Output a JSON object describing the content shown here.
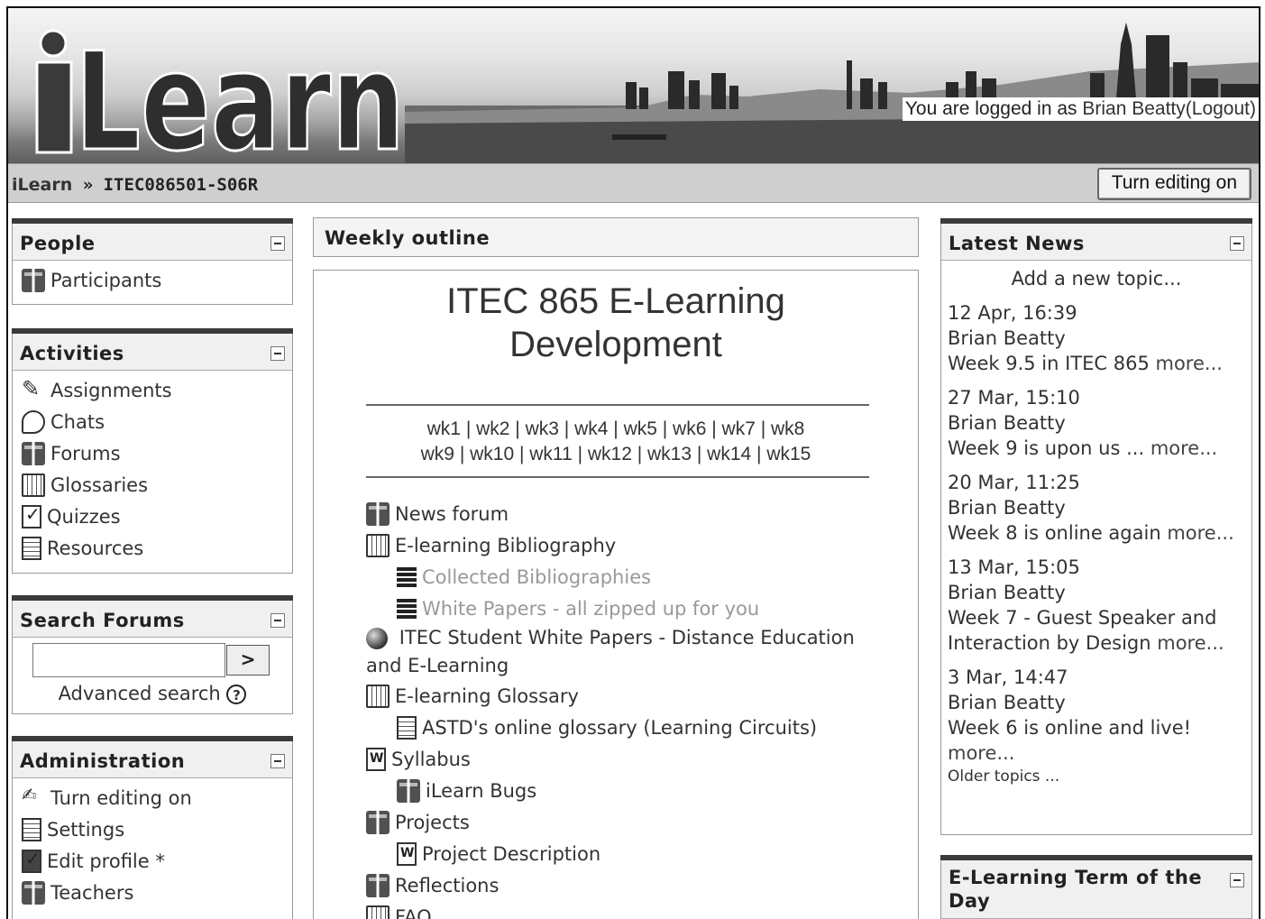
{
  "header": {
    "logo_text": "iLearn",
    "login_prefix": "You are logged in as",
    "user_name": "Brian Beatty",
    "logout_label": "(Logout)"
  },
  "navbar": {
    "home": "iLearn",
    "separator": "»",
    "course_code": "ITEC086501-S06R",
    "edit_button": "Turn editing on"
  },
  "people": {
    "title": "People",
    "items": [
      {
        "label": "Participants",
        "icon": "forum-icon"
      }
    ]
  },
  "activities": {
    "title": "Activities",
    "items": [
      {
        "label": "Assignments",
        "icon": "assignment-icon"
      },
      {
        "label": "Chats",
        "icon": "chat-icon"
      },
      {
        "label": "Forums",
        "icon": "forum-icon"
      },
      {
        "label": "Glossaries",
        "icon": "glossary-icon"
      },
      {
        "label": "Quizzes",
        "icon": "quiz-icon"
      },
      {
        "label": "Resources",
        "icon": "resource-icon"
      }
    ]
  },
  "search_forums": {
    "title": "Search Forums",
    "go_label": ">",
    "advanced_label": "Advanced search",
    "help_label": "?"
  },
  "administration": {
    "title": "Administration",
    "items": [
      {
        "label": "Turn editing on",
        "icon": "edit-pen-icon"
      },
      {
        "label": "Settings",
        "icon": "settings-icon"
      },
      {
        "label": "Edit profile *",
        "icon": "profile-icon"
      },
      {
        "label": "Teachers",
        "icon": "forum-icon"
      }
    ]
  },
  "weekly_outline": {
    "title": "Weekly outline",
    "course_title_line1": "ITEC 865 E-Learning",
    "course_title_line2": "Development",
    "weeks_row1": [
      "wk1",
      "wk2",
      "wk3",
      "wk4",
      "wk5",
      "wk6",
      "wk7",
      "wk8"
    ],
    "weeks_row2": [
      "wk9",
      "wk10",
      "wk11",
      "wk12",
      "wk13",
      "wk14",
      "wk15"
    ],
    "resources": [
      {
        "label": "News forum",
        "icon": "forum-icon"
      },
      {
        "label": "E-learning Bibliography",
        "icon": "glossary-icon"
      },
      {
        "label": "Collected Bibliographies",
        "icon": "stack-icon"
      },
      {
        "label": "White Papers - all zipped up for you",
        "icon": "stack-icon"
      },
      {
        "label_line1": "ITEC Student White Papers - Distance Education",
        "label_line2": "and E-Learning",
        "icon": "globe-icon"
      },
      {
        "label": "E-learning Glossary",
        "icon": "glossary-icon"
      },
      {
        "label": "ASTD's online glossary (Learning Circuits)",
        "icon": "file-icon"
      },
      {
        "label": "Syllabus",
        "icon": "word-doc-icon"
      },
      {
        "label": "iLearn Bugs",
        "icon": "forum-icon"
      },
      {
        "label": "Projects",
        "icon": "forum-icon"
      },
      {
        "label": "Project Description",
        "icon": "word-doc-icon"
      },
      {
        "label": "Reflections",
        "icon": "forum-icon"
      },
      {
        "label": "FAQ",
        "icon": "glossary-icon"
      }
    ]
  },
  "latest_news": {
    "title": "Latest News",
    "add_topic": "Add a new topic...",
    "posts": [
      {
        "date": "12 Apr, 16:39",
        "author": "Brian Beatty",
        "text": "Week 9.5 in ITEC 865",
        "more": "more..."
      },
      {
        "date": "27 Mar, 15:10",
        "author": "Brian Beatty",
        "text": "Week 9 is upon us ...",
        "more": "more..."
      },
      {
        "date": "20 Mar, 11:25",
        "author": "Brian Beatty",
        "text": "Week 8 is online again",
        "more": "more..."
      },
      {
        "date": "13 Mar, 15:05",
        "author": "Brian Beatty",
        "text_line1": "Week 7 - Guest Speaker and",
        "text_line2": "Interaction by Design",
        "more": "more..."
      },
      {
        "date": "3 Mar, 14:47",
        "author": "Brian Beatty",
        "text": "Week 6 is online and live!",
        "more": "more..."
      }
    ],
    "older": "Older topics ..."
  },
  "term_of_day": {
    "title": "E-Learning Term of the Day"
  }
}
